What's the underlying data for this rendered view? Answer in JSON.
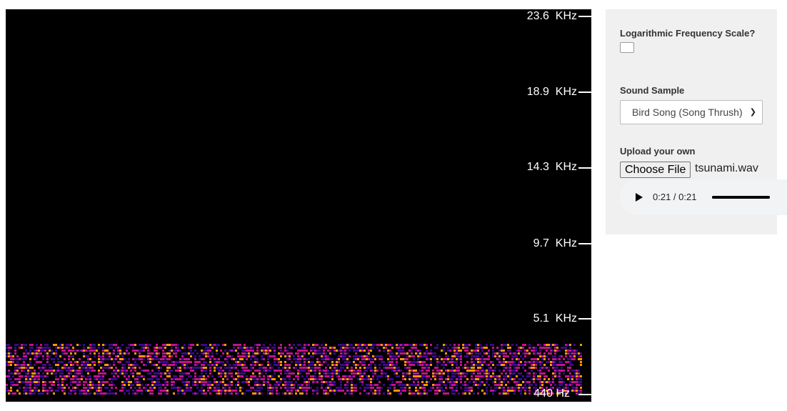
{
  "spectrogram": {
    "frequency_labels": [
      {
        "value": "23.6",
        "unit": "KHz"
      },
      {
        "value": "18.9",
        "unit": "KHz"
      },
      {
        "value": "14.3",
        "unit": "KHz"
      },
      {
        "value": "9.7",
        "unit": "KHz"
      },
      {
        "value": "5.1",
        "unit": "KHz"
      },
      {
        "value": "440",
        "unit": "Hz"
      }
    ],
    "colors": {
      "background": "#000000",
      "low": "#3a0a8a",
      "mid": "#c2128c",
      "high": "#ff9a00"
    }
  },
  "controls": {
    "log_scale_label": "Logarithmic Frequency Scale?",
    "log_scale_checked": false,
    "sound_sample_label": "Sound Sample",
    "sound_sample_selected": "Bird Song (Song Thrush)",
    "upload_label": "Upload your own",
    "choose_file_label": "Choose File",
    "file_name": "tsunami.wav"
  },
  "audio_player": {
    "play_icon": "play-icon",
    "time_display": "0:21 / 0:21",
    "progress": 1.0
  }
}
